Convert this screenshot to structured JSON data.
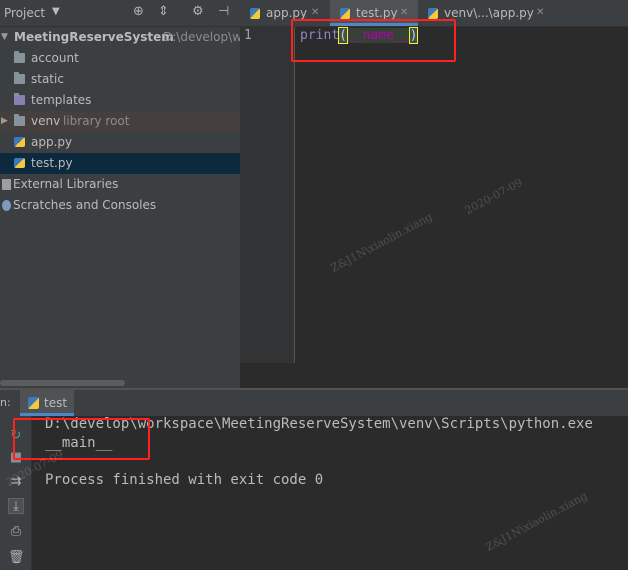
{
  "project_panel": {
    "title": "Project",
    "tree": {
      "root_name": "MeetingReserveSystem",
      "root_path": "D:\\develop\\w",
      "items": [
        {
          "label": "account",
          "type": "folder"
        },
        {
          "label": "static",
          "type": "folder"
        },
        {
          "label": "templates",
          "type": "folder"
        },
        {
          "label": "venv",
          "extra": "library root",
          "type": "folder"
        },
        {
          "label": "app.py",
          "type": "python-file"
        },
        {
          "label": "test.py",
          "type": "python-file"
        }
      ],
      "external_libraries": "External Libraries",
      "scratches": "Scratches and Consoles"
    }
  },
  "editor": {
    "tabs": [
      {
        "label": "app.py"
      },
      {
        "label": "test.py",
        "active": true
      },
      {
        "label": "venv\\...\\app.py"
      }
    ],
    "line_number": "1",
    "code": {
      "kw": "print",
      "open": "(",
      "arg": "__name__",
      "close": ")"
    }
  },
  "run_panel": {
    "prefix": "n:",
    "tab_label": "test",
    "console_lines": [
      "D:\\develop\\workspace\\MeetingReserveSystem\\venv\\Scripts\\python.exe",
      "__main__",
      "",
      "Process finished with exit code 0"
    ]
  },
  "watermark": {
    "name": "Z&J1N\\xiaolin.xiang",
    "date": "2020-07-09"
  },
  "colors": {
    "accent": "#4a88c7",
    "highlight_box": "#ff2020",
    "selected_row": "#0d293e"
  }
}
